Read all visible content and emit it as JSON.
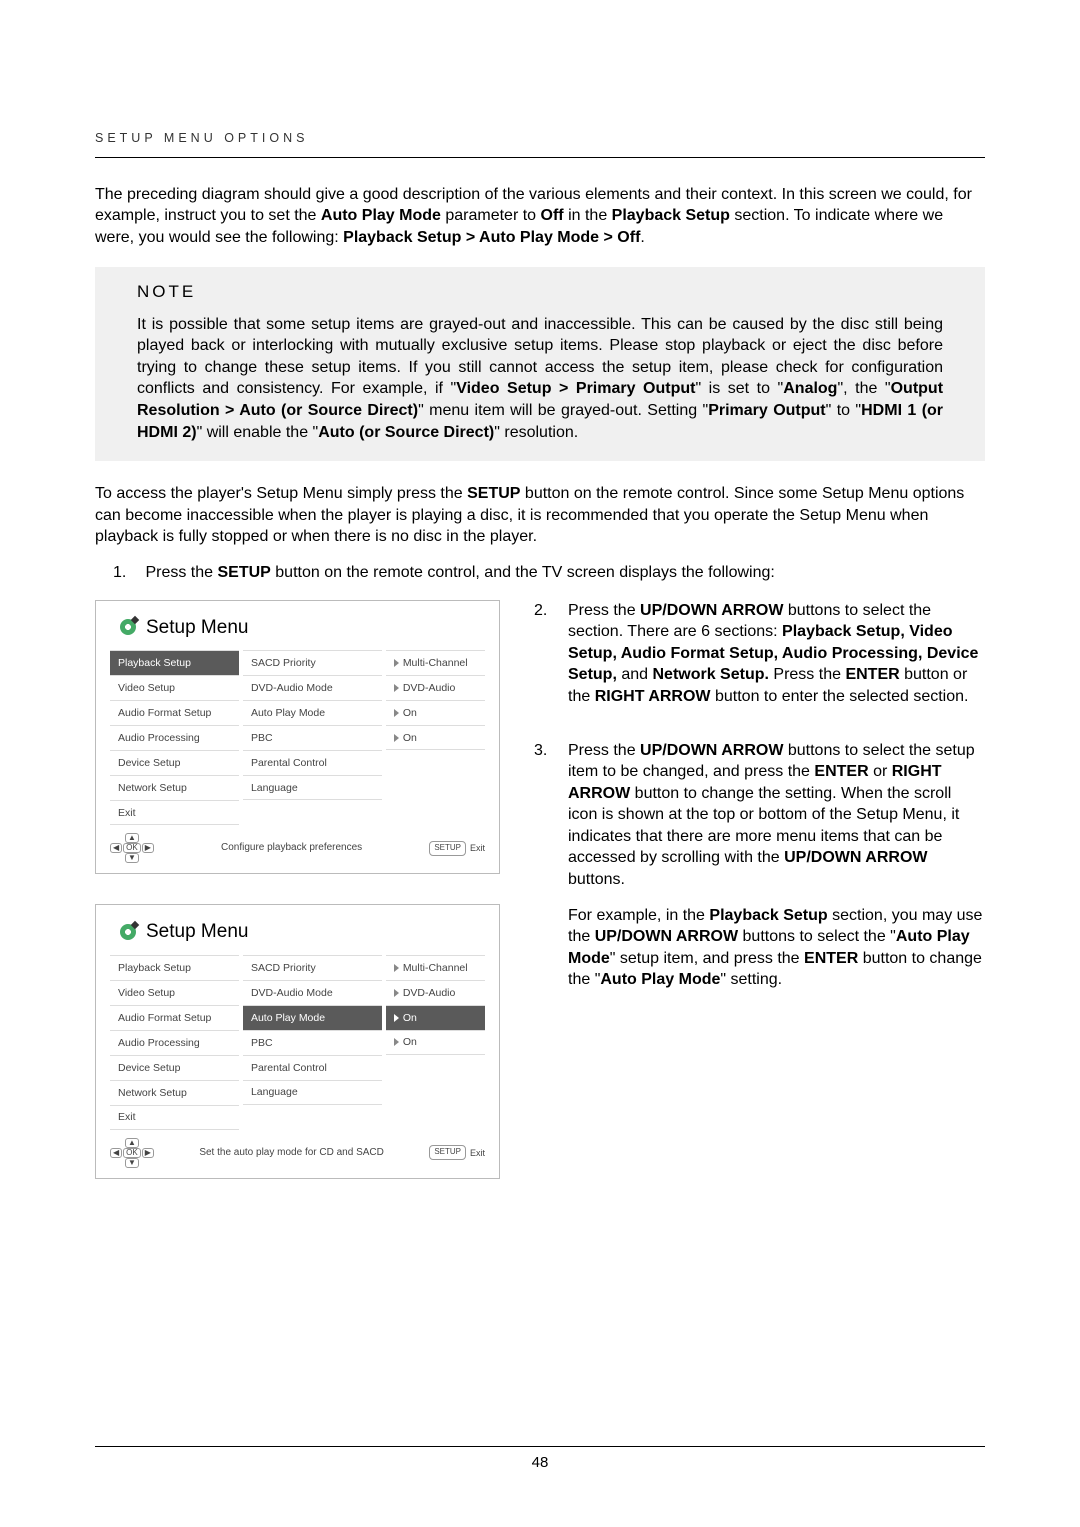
{
  "header": "SETUP MENU OPTIONS",
  "intro": {
    "p1a": "The preceding diagram should give a good description of the various elements and their context.  In this screen we could, for example, instruct you to set the ",
    "b1": "Auto Play Mode",
    "p1b": " parameter to ",
    "b2": "Off",
    "p1c": " in the ",
    "b3": "Playback Setup",
    "p1d": " section. To indicate where we were, you would see the following: ",
    "b4": "Playback Setup > Auto Play Mode > Off",
    "p1e": "."
  },
  "note": {
    "title": "NOTE",
    "body_a": "It is possible that some setup items are grayed-out and inaccessible.  This can be caused by the disc still being played back or interlocking with mutually exclusive setup items.  Please stop playback or eject the disc before trying to change these setup items. If you still cannot access the setup item, please check for configuration conflicts and consistency.  For example, if \"",
    "b1": "Video Setup > Primary Output",
    "body_b": "\" is set to \"",
    "b2": "Analog",
    "body_c": "\", the \"",
    "b3": "Output Resolution > Auto (or Source Direct)",
    "body_d": "\" menu item will be grayed-out.  Setting \"",
    "b4": "Primary Output",
    "body_e": "\" to \"",
    "b5": "HDMI 1 (or HDMI 2)",
    "body_f": "\" will enable the \"",
    "b6": "Auto (or Source Direct)",
    "body_g": "\" resolution."
  },
  "after_note": {
    "p_a": "To access the player's Setup Menu simply press the ",
    "b1": "SETUP",
    "p_b": " button on the remote control.  Since some Setup Menu options can become inaccessible when the player is playing a disc, it is recommended that you operate the Setup Menu when playback is fully stopped or when there is no disc in the player."
  },
  "step1": {
    "num": "1.",
    "t_a": "Press the ",
    "b1": "SETUP",
    "t_b": " button on the remote control, and the TV screen displays the following:"
  },
  "menu_title": "Setup Menu",
  "menu_sections": [
    "Playback Setup",
    "Video Setup",
    "Audio Format Setup",
    "Audio Processing",
    "Device Setup",
    "Network Setup",
    "Exit"
  ],
  "menu_items": [
    "SACD Priority",
    "DVD-Audio Mode",
    "Auto Play Mode",
    "PBC",
    "Parental Control",
    "Language"
  ],
  "menu_values": [
    "Multi-Channel",
    "DVD-Audio",
    "On",
    "On"
  ],
  "menu1": {
    "selected_section": "Playback Setup",
    "hint": "Configure playback preferences"
  },
  "menu2": {
    "selected_item": "Auto Play Mode",
    "hint": "Set the auto play mode for CD and SACD"
  },
  "foot_ok": "OK",
  "foot_setup": "SETUP",
  "foot_exit": "Exit",
  "step2": {
    "num": "2.",
    "t_a": "Press the ",
    "b1": "UP/DOWN ARROW",
    "t_b": " buttons to select the section.  There are 6 sections: ",
    "b2": "Playback Setup, Video Setup, Audio Format Setup, Audio Processing, Device Setup,",
    "t_c": " and ",
    "b3": "Network Setup.",
    "t_d": " Press the ",
    "b4": "ENTER",
    "t_e": " button or the ",
    "b5": "RIGHT ARROW",
    "t_f": " button to enter the selected section."
  },
  "step3": {
    "num": "3.",
    "p1_a": "Press the ",
    "b1": "UP/DOWN ARROW",
    "p1_b": " buttons to select the setup item to be changed, and press the ",
    "b2": "ENTER",
    "p1_c": " or ",
    "b3": "RIGHT ARROW",
    "p1_d": " button to change the setting.  When the scroll icon is shown at the top or bottom of the Setup Menu, it indicates that there are more menu items that can be accessed by scrolling with the ",
    "b4": "UP/DOWN ARROW",
    "p1_e": " buttons.",
    "p2_a": "For example, in the ",
    "b5": "Playback Setup",
    "p2_b": " section, you may use the ",
    "b6": "UP/DOWN ARROW",
    "p2_c": " buttons to select the \"",
    "b7": "Auto Play Mode",
    "p2_d": "\" setup item, and press the ",
    "b8": "ENTER",
    "p2_e": " button to change the \"",
    "b9": "Auto Play Mode",
    "p2_f": "\" setting."
  },
  "page_num": "48"
}
